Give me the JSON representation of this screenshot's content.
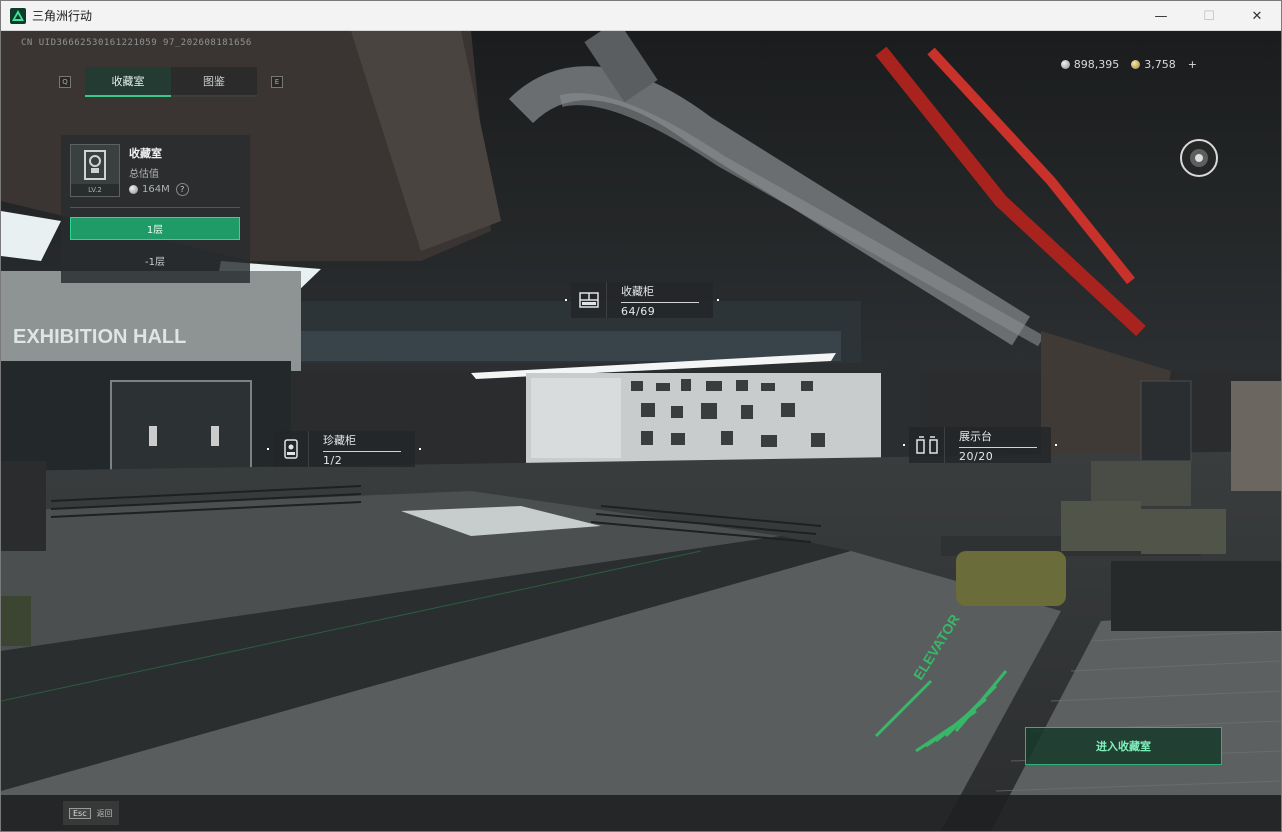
{
  "window": {
    "title": "三角洲行动",
    "minimize": "—",
    "maximize": "☐",
    "close": "✕"
  },
  "uid": "CN UID36662530161221059 97_202608181656",
  "tabs": [
    {
      "label": "收藏室",
      "active": true
    },
    {
      "label": "图鉴",
      "active": false
    }
  ],
  "tab_keys": {
    "left": "Q",
    "right": "E"
  },
  "currency": {
    "silver": "898,395",
    "gold": "3,758",
    "add": "+"
  },
  "room_panel": {
    "name": "收藏室",
    "level": "LV.2",
    "value_label": "总估值",
    "value": "164M",
    "help": "?",
    "floors": [
      "1层",
      "-1层"
    ]
  },
  "scene_labels": {
    "exhibition_hall": "EXHIBITION HALL",
    "elevator": "ELEVATOR"
  },
  "pois": [
    {
      "name": "收藏柜",
      "count": "64/69",
      "icon": "cabinet-icon"
    },
    {
      "name": "珍藏柜",
      "count": "1/2",
      "icon": "treasure-case-icon"
    },
    {
      "name": "展示台",
      "count": "20/20",
      "icon": "display-stand-icon"
    }
  ],
  "enter_button": "进入收藏室",
  "esc": {
    "key": "Esc",
    "label": "返回"
  }
}
